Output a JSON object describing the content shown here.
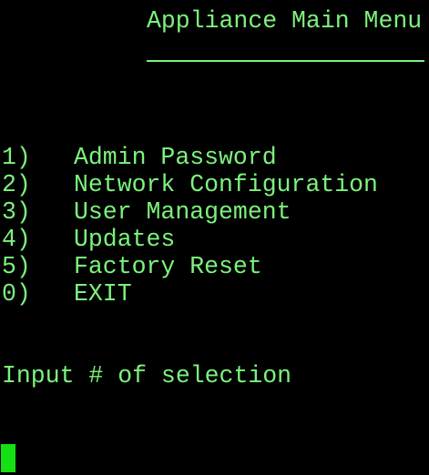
{
  "menu": {
    "title": "Appliance Main Menu",
    "items": [
      {
        "key": "1)",
        "label": "Admin Password"
      },
      {
        "key": "2)",
        "label": "Network Configuration"
      },
      {
        "key": "3)",
        "label": "User Management"
      },
      {
        "key": "4)",
        "label": "Updates"
      },
      {
        "key": "5)",
        "label": "Factory Reset"
      },
      {
        "key": "0)",
        "label": "EXIT"
      }
    ],
    "prompt": "Input # of selection"
  },
  "colors": {
    "background": "#000000",
    "text": "#7cf27c",
    "cursor": "#14e014"
  }
}
